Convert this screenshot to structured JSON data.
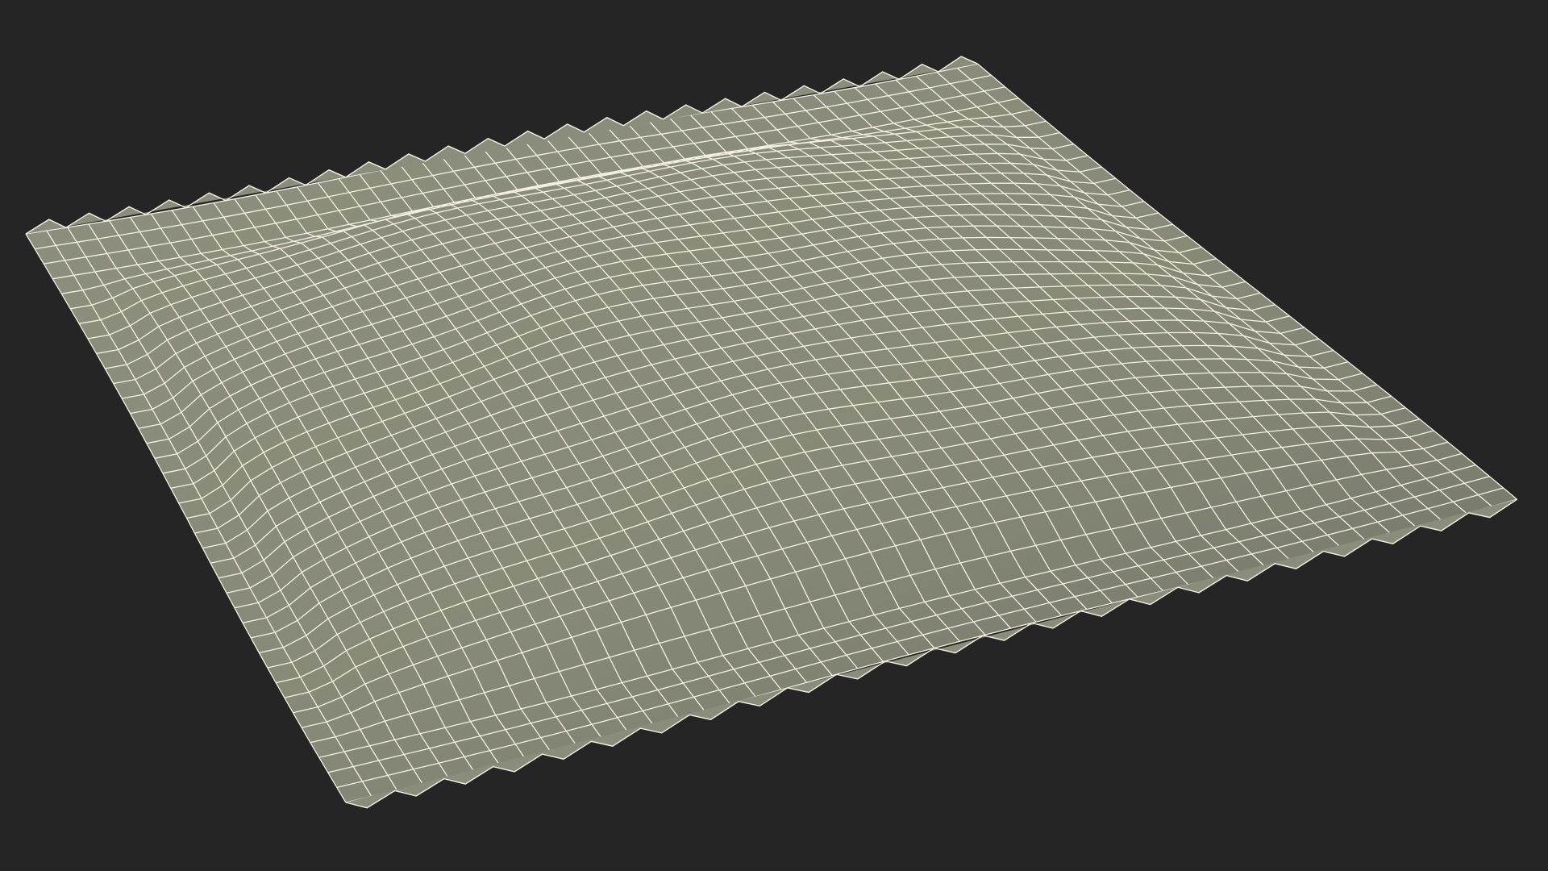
{
  "scene": {
    "background_color": "#252525",
    "object": "sachet-packet-wireframe",
    "shading": "wireframe-on-shaded",
    "surface_color": "#8a8c7c",
    "surface_shadow_color": "#6f7164",
    "wire_color": "#f4f2e2",
    "grid_resolution": {
      "u": 46,
      "v": 38
    },
    "serrated_seals": [
      "top-edge",
      "bottom-edge"
    ],
    "serration_teeth_per_edge": 24
  }
}
